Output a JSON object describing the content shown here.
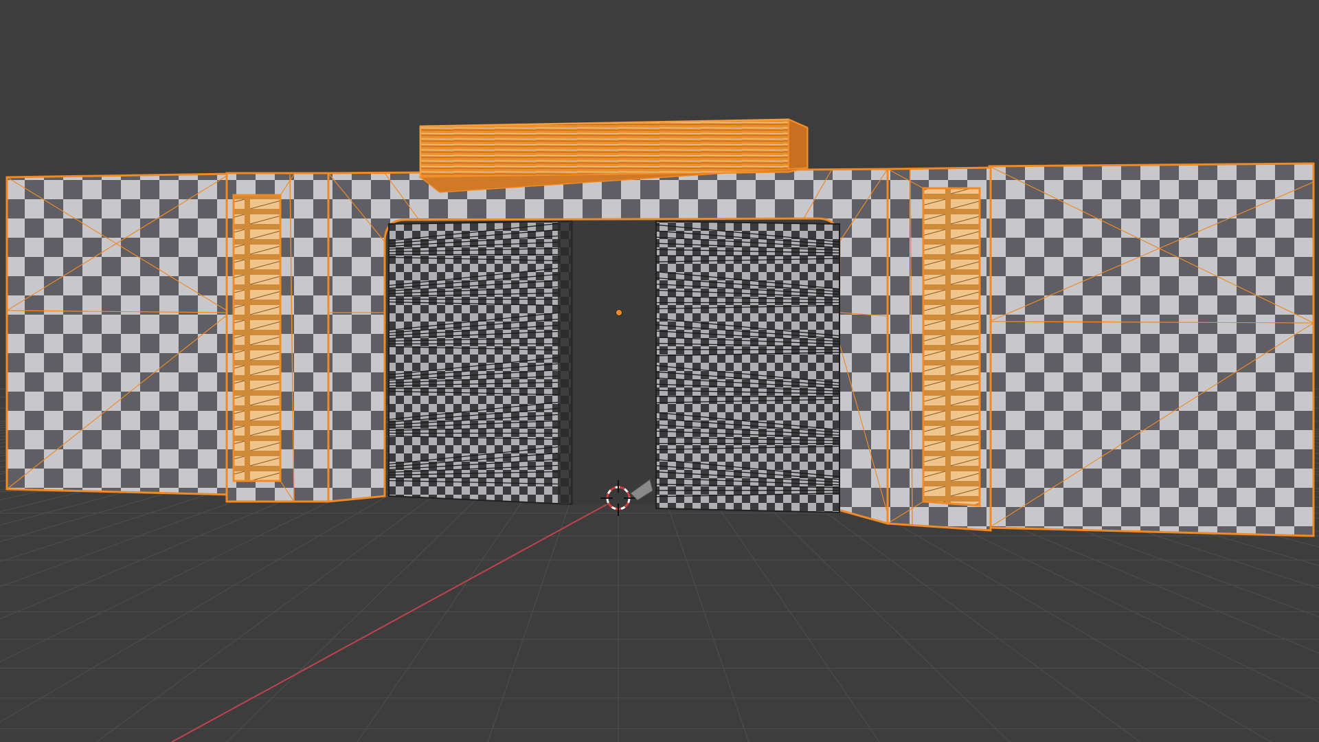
{
  "app": {
    "viewport_mode": "3d-viewport",
    "shading": "textured-checker",
    "selection_state": "all-selected"
  },
  "colors": {
    "background": "#3d3d3d",
    "grid": "#4c4c4c",
    "selection_outline": "#f08a24",
    "selection_fill": "#e8902e",
    "checker_light": "#c8c8cc",
    "checker_dark": "#5e5e64",
    "door_light": "#b0b0b4",
    "door_dark": "#3a3a3c",
    "x_axis": "#c0434d",
    "y_axis": "#7fae3a",
    "origin_dot": "#f08a24"
  },
  "scene": {
    "objects": [
      {
        "name": "wall-left",
        "icon": "mesh-object-icon"
      },
      {
        "name": "pillar-left",
        "icon": "mesh-object-icon"
      },
      {
        "name": "arch-frame",
        "icon": "mesh-object-icon"
      },
      {
        "name": "door-left",
        "icon": "mesh-object-icon"
      },
      {
        "name": "door-right",
        "icon": "mesh-object-icon"
      },
      {
        "name": "lintel-beam",
        "icon": "mesh-object-icon"
      },
      {
        "name": "pillar-right",
        "icon": "mesh-object-icon"
      },
      {
        "name": "wall-right",
        "icon": "mesh-object-icon"
      }
    ],
    "cursor_icon": "3d-cursor-icon",
    "origin_icon": "object-origin-icon"
  }
}
